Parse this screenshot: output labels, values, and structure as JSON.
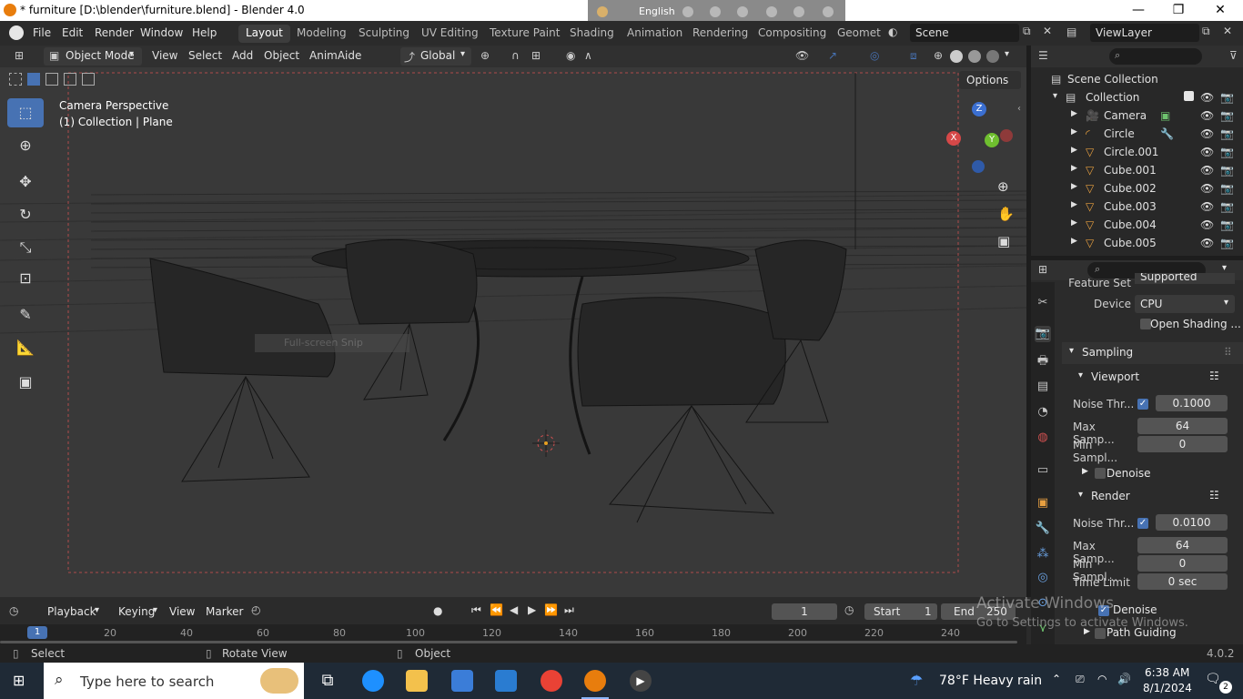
{
  "window": {
    "title": "* furniture [D:\\blender\\furniture.blend] - Blender 4.0",
    "minimize": "—",
    "restore": "❐",
    "close": "✕"
  },
  "language_bar": {
    "label": "English"
  },
  "menubar": {
    "items": [
      "File",
      "Edit",
      "Render",
      "Window",
      "Help"
    ],
    "workspaces": [
      "Layout",
      "Modeling",
      "Sculpting",
      "UV Editing",
      "Texture Paint",
      "Shading",
      "Animation",
      "Rendering",
      "Compositing",
      "Geomet"
    ],
    "active_workspace": "Layout",
    "scene": "Scene",
    "view_layer": "ViewLayer"
  },
  "viewport_header": {
    "mode": "Object Mode",
    "menus": [
      "View",
      "Select",
      "Add",
      "Object",
      "AnimAide"
    ],
    "orientation": "Global",
    "options": "Options"
  },
  "viewport": {
    "camera_label": "Camera Perspective",
    "collection_label": "(1) Collection | Plane",
    "snip_label": "Full-screen Snip",
    "gizmo": {
      "z": "Z",
      "x": "X",
      "y": "Y"
    }
  },
  "outliner": {
    "root": "Scene Collection",
    "collection": "Collection",
    "items": [
      "Camera",
      "Circle",
      "Circle.001",
      "Cube.001",
      "Cube.002",
      "Cube.003",
      "Cube.004",
      "Cube.005"
    ]
  },
  "properties": {
    "feature_set_label": "Feature Set",
    "feature_set_value": "Supported",
    "device_label": "Device",
    "device_value": "CPU",
    "open_shading": "Open Shading ...",
    "sampling": "Sampling",
    "viewport_section": "Viewport",
    "viewport_noise_label": "Noise Thr...",
    "viewport_noise_value": "0.1000",
    "viewport_max_label": "Max Samp...",
    "viewport_max_value": "64",
    "viewport_min_label": "Min Sampl...",
    "viewport_min_value": "0",
    "denoise_label": "Denoise",
    "render_section": "Render",
    "render_noise_label": "Noise Thr...",
    "render_noise_value": "0.0100",
    "render_max_label": "Max Samp...",
    "render_max_value": "64",
    "render_min_label": "Min Sampl...",
    "render_min_value": "0",
    "time_limit_label": "Time Limit",
    "time_limit_value": "0 sec",
    "render_denoise_label": "Denoise",
    "path_guiding_label": "Path Guiding"
  },
  "timeline": {
    "menus": [
      "Playback",
      "Keying",
      "View",
      "Marker"
    ],
    "current_frame": "1",
    "start_label": "Start",
    "start_value": "1",
    "end_label": "End",
    "end_value": "250",
    "ruler": [
      "1",
      "20",
      "40",
      "60",
      "80",
      "100",
      "120",
      "140",
      "160",
      "180",
      "200",
      "220",
      "240"
    ]
  },
  "watermark": {
    "line1": "Activate Windows",
    "line2": "Go to Settings to activate Windows."
  },
  "statusbar": {
    "select": "Select",
    "rotate": "Rotate View",
    "object": "Object",
    "version": "4.0.2"
  },
  "taskbar": {
    "search_placeholder": "Type here to search",
    "weather": "78°F  Heavy rain",
    "time": "6:38 AM",
    "date": "8/1/2024",
    "notifications": "2"
  },
  "colors": {
    "accent": "#4772b3",
    "blender_orange": "#e87d0d",
    "bg_dark": "#1d1d1d"
  }
}
